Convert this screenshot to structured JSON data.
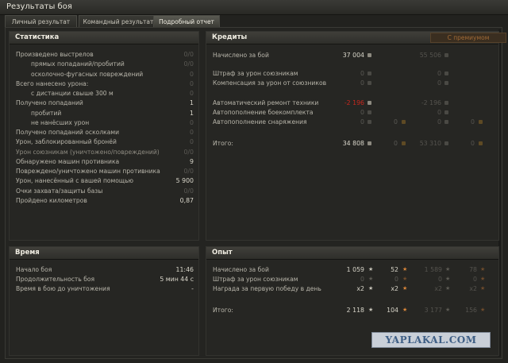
{
  "window": {
    "title": "Результаты боя"
  },
  "tabs": [
    {
      "label": "Личный результат"
    },
    {
      "label": "Командный результат"
    },
    {
      "label": "Подробный отчет"
    }
  ],
  "stats": {
    "title": "Статистика",
    "rows": [
      {
        "label": "Произведено выстрелов",
        "value": "0/0"
      },
      {
        "label": "прямых попаданий/пробитий",
        "value": "0/0"
      },
      {
        "label": "осколочно-фугасных повреждений",
        "value": "0"
      },
      {
        "label": "Всего нанесено урона:",
        "value": "0"
      },
      {
        "label": "с дистанции свыше 300 м",
        "value": "0"
      },
      {
        "label": "Получено попаданий",
        "value": "1"
      },
      {
        "label": "пробитий",
        "value": "1"
      },
      {
        "label": "не нанёсших урон",
        "value": "0"
      },
      {
        "label": "Получено попаданий осколками",
        "value": "0"
      },
      {
        "label": "Урон, заблокированный бронёй",
        "value": "0"
      },
      {
        "label": "Урон союзникам (уничтожено/повреждений)",
        "value": "0/0"
      },
      {
        "label": "Обнаружено машин противника",
        "value": "9"
      },
      {
        "label": "Повреждено/уничтожено машин противника",
        "value": "0/0"
      },
      {
        "label": "Урон, нанесённый с вашей помощью",
        "value": "5 900"
      },
      {
        "label": "Очки захвата/защиты базы",
        "value": "0/0"
      },
      {
        "label": "Пройдено километров",
        "value": "0,87"
      }
    ]
  },
  "credits": {
    "title": "Кредиты",
    "premium_label": "С премиумом",
    "rows": [
      {
        "label": "Начислено за бой",
        "value": "37 004",
        "premium": "55 506"
      },
      {
        "label": "Штраф за урон союзникам",
        "value": "0",
        "premium": "0"
      },
      {
        "label": "Компенсация за урон от союзников",
        "value": "0",
        "premium": "0"
      },
      {
        "label": "Автоматический ремонт техники",
        "value": "-2 196",
        "premium": "-2 196"
      },
      {
        "label": "Автопополнение боекомплекта",
        "value": "0",
        "premium": "0"
      },
      {
        "label": "Автопополнение снаряжения",
        "value": "0",
        "gold": "0",
        "premium": "0",
        "premium_gold": "0"
      }
    ],
    "total": {
      "label": "Итого:",
      "value": "34 808",
      "gold": "0",
      "premium": "53 310",
      "premium_gold": "0"
    }
  },
  "time": {
    "title": "Время",
    "rows": [
      {
        "label": "Начало боя",
        "value": "11:46"
      },
      {
        "label": "Продолжительность боя",
        "value": "5 мин 44 с"
      },
      {
        "label": "Время в бою до уничтожения",
        "value": "-"
      }
    ]
  },
  "xp": {
    "title": "Опыт",
    "rows": [
      {
        "label": "Начислено за бой",
        "value": "1 059",
        "free": "52",
        "premium": "1 589",
        "premium_free": "78"
      },
      {
        "label": "Штраф за урон союзникам",
        "value": "0",
        "free": "0",
        "premium": "0",
        "premium_free": "0"
      },
      {
        "label": "Награда за первую победу в день",
        "value": "x2",
        "free": "x2",
        "premium": "x2",
        "premium_free": "x2"
      }
    ],
    "total": {
      "label": "Итого:",
      "value": "2 118",
      "free": "104",
      "premium": "3 177",
      "premium_free": "156"
    }
  },
  "watermark": "YAPLAKAL.COM"
}
